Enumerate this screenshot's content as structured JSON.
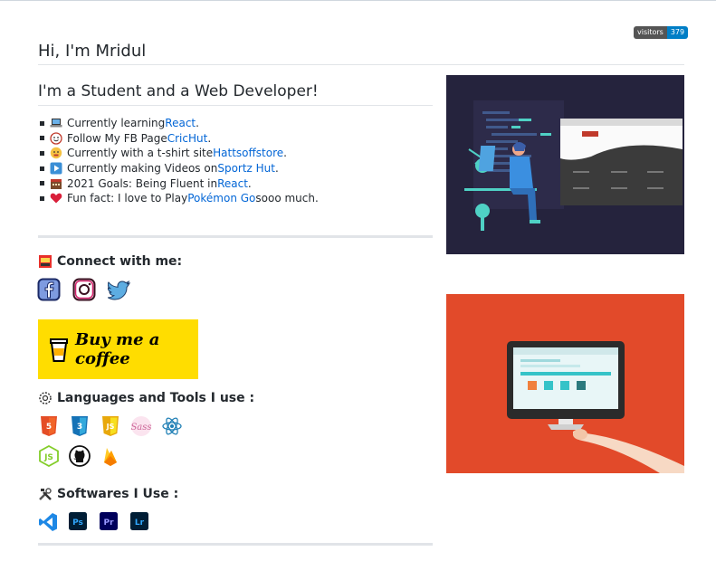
{
  "badge": {
    "label": "visitors",
    "count": "379"
  },
  "title": "Hi, I'm Mridul",
  "subtitle": "I'm a Student and a Web Developer!",
  "about": [
    {
      "icon": "laptop-icon",
      "prefix": "Currently learning ",
      "link": "React",
      "suffix": "."
    },
    {
      "icon": "smile-icon",
      "prefix": "Follow My FB Page ",
      "link": "CricHut",
      "suffix": "."
    },
    {
      "icon": "tshirt-icon",
      "prefix": "Currently with a t-shirt site ",
      "link": "Hattsoffstore",
      "suffix": "."
    },
    {
      "icon": "play-icon",
      "prefix": "Currently making Videos on ",
      "link": "Sportz Hut",
      "suffix": "."
    },
    {
      "icon": "calendar-icon",
      "prefix": "2021 Goals: Being Fluent in ",
      "link": "React",
      "suffix": "."
    },
    {
      "icon": "heart-icon",
      "prefix": "Fun fact: I love to Play ",
      "link": "Pokémon Go",
      "suffix": " sooo much."
    }
  ],
  "connect": {
    "heading": "Connect with me:"
  },
  "coffee": {
    "label": "Buy me a coffee"
  },
  "languages": {
    "heading": "Languages and Tools I use :"
  },
  "softwares": {
    "heading": "Softwares I Use :"
  },
  "software_labels": {
    "ps": "Ps",
    "pr": "Pr",
    "lr": "Lr"
  },
  "colors": {
    "link": "#0366d6",
    "coffee_bg": "#ffdd00",
    "badge_count": "#007ec6"
  }
}
